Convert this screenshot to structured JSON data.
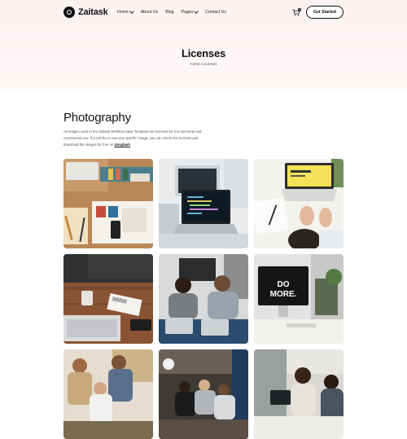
{
  "brand": {
    "name": "Zaitask"
  },
  "nav": {
    "items": [
      {
        "label": "Home",
        "dropdown": true
      },
      {
        "label": "About Us",
        "dropdown": false
      },
      {
        "label": "Blog",
        "dropdown": false
      },
      {
        "label": "Pages",
        "dropdown": true
      },
      {
        "label": "Contact Us",
        "dropdown": false
      }
    ],
    "cart_count": "0",
    "cta_label": "Get Started"
  },
  "hero": {
    "title": "Licenses",
    "breadcrumb": "Home / Licenses"
  },
  "section": {
    "title": "Photography",
    "description": "All images used in the Zaitask Webflow Saas Template are licensed for free personal and commercial use. If you'd like to use any specific image, you can check the licenses and download the images for free on",
    "link_label": "Unsplash"
  },
  "gallery": {
    "icons": [
      "desk-supplies-photo",
      "laptop-code-photo",
      "laptop-notebook-photo",
      "laptop-mug-photo",
      "meeting-two-men-photo",
      "imac-do-more-photo",
      "team-meeting-photo",
      "team-table-photo",
      "women-laptop-photo"
    ]
  }
}
